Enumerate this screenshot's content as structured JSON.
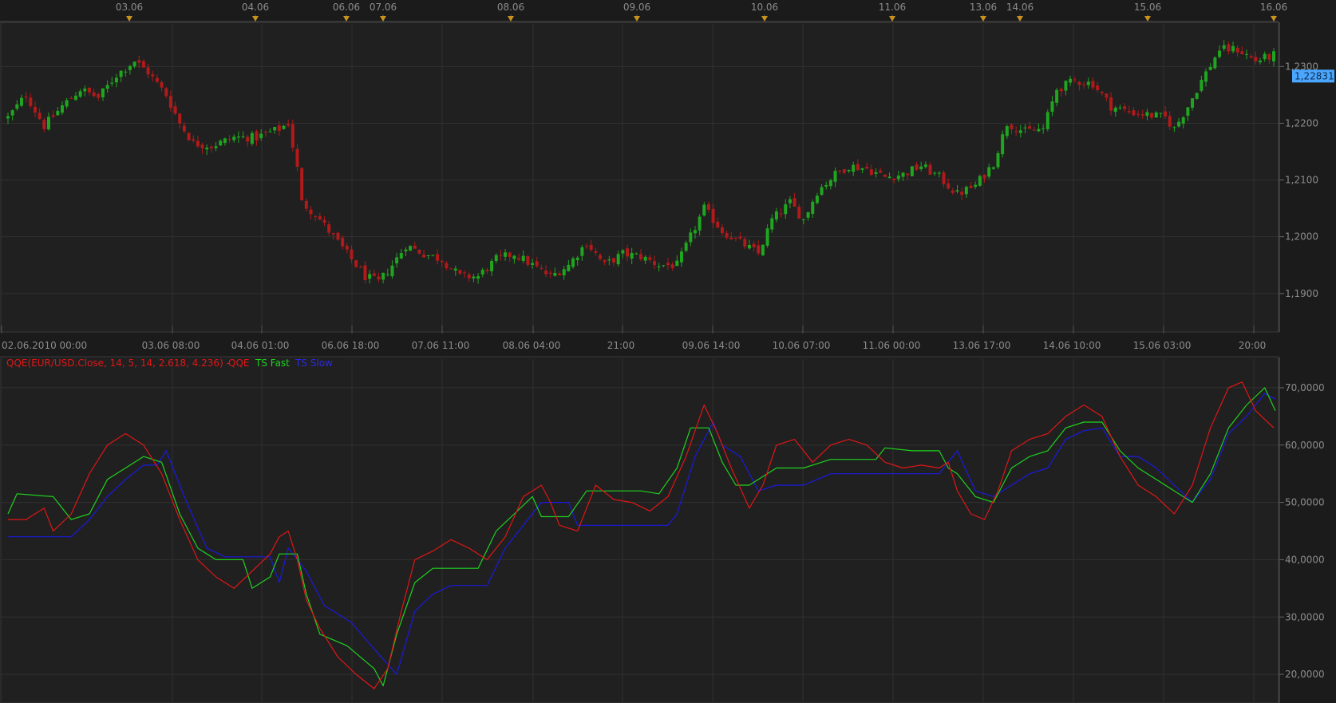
{
  "colors": {
    "background": "#1b1b1b",
    "panel": "#202020",
    "grid": "#303030",
    "axis_text": "#8c8c8c",
    "bull": "#1fa51f",
    "bear": "#b01a1a",
    "event_marker": "#c8921e",
    "price_tag_bg": "#4aa6ff",
    "qqe": "#e01616",
    "ts_fast": "#1fd21f",
    "ts_slow": "#1a1ae0"
  },
  "top_axis": {
    "labels": [
      "03.06",
      "04.06",
      "06.06",
      "07.06",
      "08.06",
      "09.06",
      "10.06",
      "11.06",
      "13.06",
      "14.06",
      "15.06",
      "16.06"
    ]
  },
  "bottom_axis": {
    "labels": [
      "02.06.2010 00:00",
      "03.06 08:00",
      "04.06 01:00",
      "06.06 18:00",
      "07.06 11:00",
      "08.06 04:00",
      "21:00",
      "09.06 14:00",
      "10.06 07:00",
      "11.06 00:00",
      "13.06 17:00",
      "14.06 10:00",
      "15.06 03:00",
      "20:00"
    ]
  },
  "price_panel": {
    "current_price": "1,22831",
    "y_ticks": [
      "1,2300",
      "1,2200",
      "1,2100",
      "1,2000",
      "1,1900"
    ]
  },
  "indicator_panel": {
    "legend": {
      "main": "QQE(EUR/USD.Close, 14, 5, 14, 2.618, 4.236) -",
      "qqe": "QQE",
      "ts_fast": "TS Fast",
      "ts_slow": "TS Slow"
    },
    "y_ticks": [
      "70,0000",
      "60,0000",
      "50,0000",
      "40,0000",
      "30,0000",
      "20,0000"
    ]
  },
  "chart_data": [
    {
      "type": "candlestick",
      "instrument": "EUR/USD",
      "ylim": [
        1.1835,
        1.2375
      ],
      "y_ticks": [
        1.23,
        1.22,
        1.21,
        1.2,
        1.19
      ],
      "last_price": 1.22831,
      "anchors": [
        [
          0,
          1.221
        ],
        [
          4,
          1.225
        ],
        [
          8,
          1.2195
        ],
        [
          12,
          1.223
        ],
        [
          16,
          1.226
        ],
        [
          20,
          1.2245
        ],
        [
          24,
          1.2285
        ],
        [
          28,
          1.231
        ],
        [
          31,
          1.229
        ],
        [
          35,
          1.225
        ],
        [
          38,
          1.22
        ],
        [
          41,
          1.2165
        ],
        [
          45,
          1.216
        ],
        [
          50,
          1.2175
        ],
        [
          55,
          1.2175
        ],
        [
          60,
          1.219
        ],
        [
          62,
          1.22
        ],
        [
          64,
          1.212
        ],
        [
          65,
          1.206
        ],
        [
          68,
          1.204
        ],
        [
          72,
          1.2
        ],
        [
          76,
          1.196
        ],
        [
          79,
          1.193
        ],
        [
          82,
          1.192
        ],
        [
          85,
          1.195
        ],
        [
          88,
          1.1985
        ],
        [
          92,
          1.197
        ],
        [
          96,
          1.196
        ],
        [
          100,
          1.193
        ],
        [
          104,
          1.193
        ],
        [
          108,
          1.196
        ],
        [
          112,
          1.197
        ],
        [
          116,
          1.195
        ],
        [
          120,
          1.193
        ],
        [
          124,
          1.195
        ],
        [
          128,
          1.199
        ],
        [
          132,
          1.195
        ],
        [
          136,
          1.197
        ],
        [
          140,
          1.1965
        ],
        [
          144,
          1.195
        ],
        [
          148,
          1.195
        ],
        [
          151,
          1.2
        ],
        [
          154,
          1.205
        ],
        [
          158,
          1.201
        ],
        [
          162,
          1.199
        ],
        [
          166,
          1.197
        ],
        [
          169,
          1.203
        ],
        [
          173,
          1.206
        ],
        [
          176,
          1.203
        ],
        [
          179,
          1.208
        ],
        [
          183,
          1.211
        ],
        [
          186,
          1.2125
        ],
        [
          190,
          1.212
        ],
        [
          194,
          1.2105
        ],
        [
          198,
          1.211
        ],
        [
          202,
          1.2125
        ],
        [
          206,
          1.2105
        ],
        [
          210,
          1.2075
        ],
        [
          214,
          1.209
        ],
        [
          218,
          1.213
        ],
        [
          221,
          1.22
        ],
        [
          225,
          1.2185
        ],
        [
          229,
          1.219
        ],
        [
          232,
          1.226
        ],
        [
          236,
          1.2275
        ],
        [
          240,
          1.227
        ],
        [
          244,
          1.223
        ],
        [
          248,
          1.222
        ],
        [
          252,
          1.2215
        ],
        [
          256,
          1.221
        ],
        [
          258,
          1.219
        ],
        [
          261,
          1.223
        ],
        [
          264,
          1.2275
        ],
        [
          268,
          1.233
        ],
        [
          272,
          1.233
        ],
        [
          276,
          1.231
        ],
        [
          280,
          1.232
        ]
      ]
    },
    {
      "type": "line",
      "ylim": [
        15,
        75
      ],
      "y_ticks": [
        70,
        60,
        50,
        40,
        30,
        20
      ],
      "series": [
        {
          "name": "QQE",
          "points": [
            [
              0,
              47
            ],
            [
              4,
              47
            ],
            [
              8,
              49
            ],
            [
              10,
              45
            ],
            [
              14,
              48
            ],
            [
              18,
              55
            ],
            [
              22,
              60
            ],
            [
              26,
              62
            ],
            [
              30,
              60
            ],
            [
              34,
              55
            ],
            [
              38,
              47
            ],
            [
              42,
              40
            ],
            [
              46,
              37
            ],
            [
              50,
              35
            ],
            [
              54,
              38
            ],
            [
              58,
              41
            ],
            [
              60,
              44
            ],
            [
              62,
              45
            ],
            [
              64,
              40
            ],
            [
              66,
              33
            ],
            [
              69,
              28
            ],
            [
              73,
              23
            ],
            [
              77,
              20
            ],
            [
              81,
              17.5
            ],
            [
              84,
              21
            ],
            [
              87,
              31
            ],
            [
              90,
              40
            ],
            [
              94,
              41.5
            ],
            [
              98,
              43.5
            ],
            [
              102,
              42
            ],
            [
              106,
              40
            ],
            [
              110,
              44
            ],
            [
              114,
              51
            ],
            [
              118,
              53
            ],
            [
              120,
              50
            ],
            [
              122,
              46
            ],
            [
              126,
              45
            ],
            [
              128,
              49
            ],
            [
              130,
              53
            ],
            [
              134,
              50.5
            ],
            [
              138,
              50
            ],
            [
              142,
              48.5
            ],
            [
              146,
              51
            ],
            [
              150,
              58
            ],
            [
              154,
              67
            ],
            [
              157,
              62
            ],
            [
              160,
              56
            ],
            [
              164,
              49
            ],
            [
              167,
              53
            ],
            [
              170,
              60
            ],
            [
              174,
              61
            ],
            [
              178,
              57
            ],
            [
              182,
              60
            ],
            [
              186,
              61
            ],
            [
              190,
              60
            ],
            [
              194,
              57
            ],
            [
              198,
              56
            ],
            [
              202,
              56.5
            ],
            [
              206,
              56
            ],
            [
              208,
              57
            ],
            [
              210,
              52
            ],
            [
              213,
              48
            ],
            [
              216,
              47
            ],
            [
              219,
              52
            ],
            [
              222,
              59
            ],
            [
              226,
              61
            ],
            [
              230,
              62
            ],
            [
              234,
              65
            ],
            [
              238,
              67
            ],
            [
              242,
              65
            ],
            [
              246,
              58
            ],
            [
              250,
              53
            ],
            [
              254,
              51
            ],
            [
              258,
              48
            ],
            [
              262,
              53
            ],
            [
              266,
              63
            ],
            [
              270,
              70
            ],
            [
              273,
              71
            ],
            [
              276,
              66
            ],
            [
              280,
              63
            ]
          ]
        },
        {
          "name": "TS Fast",
          "points": [
            [
              0,
              48
            ],
            [
              2,
              51.5
            ],
            [
              10,
              51
            ],
            [
              14,
              47
            ],
            [
              18,
              48
            ],
            [
              22,
              54
            ],
            [
              26,
              56
            ],
            [
              30,
              58
            ],
            [
              34,
              57
            ],
            [
              38,
              48
            ],
            [
              42,
              42
            ],
            [
              46,
              40
            ],
            [
              52,
              40
            ],
            [
              54,
              35
            ],
            [
              58,
              37
            ],
            [
              60,
              41
            ],
            [
              64,
              41
            ],
            [
              66,
              34
            ],
            [
              69,
              27
            ],
            [
              75,
              25
            ],
            [
              81,
              21
            ],
            [
              83,
              18
            ],
            [
              86,
              27
            ],
            [
              90,
              36
            ],
            [
              94,
              38.5
            ],
            [
              100,
              38.5
            ],
            [
              104,
              38.5
            ],
            [
              108,
              45
            ],
            [
              112,
              48
            ],
            [
              116,
              51
            ],
            [
              118,
              47.5
            ],
            [
              124,
              47.5
            ],
            [
              128,
              52
            ],
            [
              134,
              52
            ],
            [
              140,
              52
            ],
            [
              144,
              51.5
            ],
            [
              148,
              56
            ],
            [
              151,
              63
            ],
            [
              155,
              63
            ],
            [
              158,
              57
            ],
            [
              161,
              53
            ],
            [
              164,
              53
            ],
            [
              166,
              54
            ],
            [
              170,
              56
            ],
            [
              176,
              56
            ],
            [
              182,
              57.5
            ],
            [
              188,
              57.5
            ],
            [
              192,
              57.5
            ],
            [
              194,
              59.5
            ],
            [
              200,
              59
            ],
            [
              206,
              59
            ],
            [
              208,
              56
            ],
            [
              210,
              55
            ],
            [
              214,
              51
            ],
            [
              218,
              50
            ],
            [
              222,
              56
            ],
            [
              226,
              58
            ],
            [
              230,
              59
            ],
            [
              234,
              63
            ],
            [
              238,
              64
            ],
            [
              242,
              64
            ],
            [
              246,
              59
            ],
            [
              250,
              56
            ],
            [
              254,
              54
            ],
            [
              258,
              52
            ],
            [
              262,
              50
            ],
            [
              266,
              55
            ],
            [
              270,
              63
            ],
            [
              274,
              67
            ],
            [
              278,
              70
            ],
            [
              282,
              66
            ]
          ]
        },
        {
          "name": "TS Slow",
          "points": [
            [
              0,
              44
            ],
            [
              14,
              44
            ],
            [
              18,
              47
            ],
            [
              22,
              51
            ],
            [
              26,
              54
            ],
            [
              30,
              56.5
            ],
            [
              33,
              56.5
            ],
            [
              35,
              59
            ],
            [
              39,
              51
            ],
            [
              44,
              42
            ],
            [
              48,
              40.5
            ],
            [
              58,
              40.5
            ],
            [
              60,
              36
            ],
            [
              62,
              42
            ],
            [
              66,
              38
            ],
            [
              70,
              32
            ],
            [
              76,
              29
            ],
            [
              82,
              23.5
            ],
            [
              86,
              20
            ],
            [
              90,
              31
            ],
            [
              94,
              34
            ],
            [
              98,
              35.5
            ],
            [
              106,
              35.5
            ],
            [
              110,
              42
            ],
            [
              114,
              46
            ],
            [
              118,
              50
            ],
            [
              124,
              50
            ],
            [
              126,
              46
            ],
            [
              134,
              46
            ],
            [
              146,
              46
            ],
            [
              148,
              48
            ],
            [
              152,
              58
            ],
            [
              156,
              64
            ],
            [
              158,
              60
            ],
            [
              162,
              58
            ],
            [
              166,
              52
            ],
            [
              170,
              53
            ],
            [
              176,
              53
            ],
            [
              182,
              55
            ],
            [
              190,
              55
            ],
            [
              196,
              55
            ],
            [
              200,
              55
            ],
            [
              206,
              55
            ],
            [
              210,
              59
            ],
            [
              214,
              52
            ],
            [
              218,
              51
            ],
            [
              222,
              53
            ],
            [
              226,
              55
            ],
            [
              230,
              56
            ],
            [
              234,
              61
            ],
            [
              238,
              62.5
            ],
            [
              242,
              63
            ],
            [
              246,
              58
            ],
            [
              250,
              58
            ],
            [
              254,
              56
            ],
            [
              258,
              53
            ],
            [
              262,
              50
            ],
            [
              266,
              54
            ],
            [
              270,
              62
            ],
            [
              274,
              65
            ],
            [
              278,
              69
            ],
            [
              282,
              68
            ]
          ]
        }
      ]
    }
  ]
}
